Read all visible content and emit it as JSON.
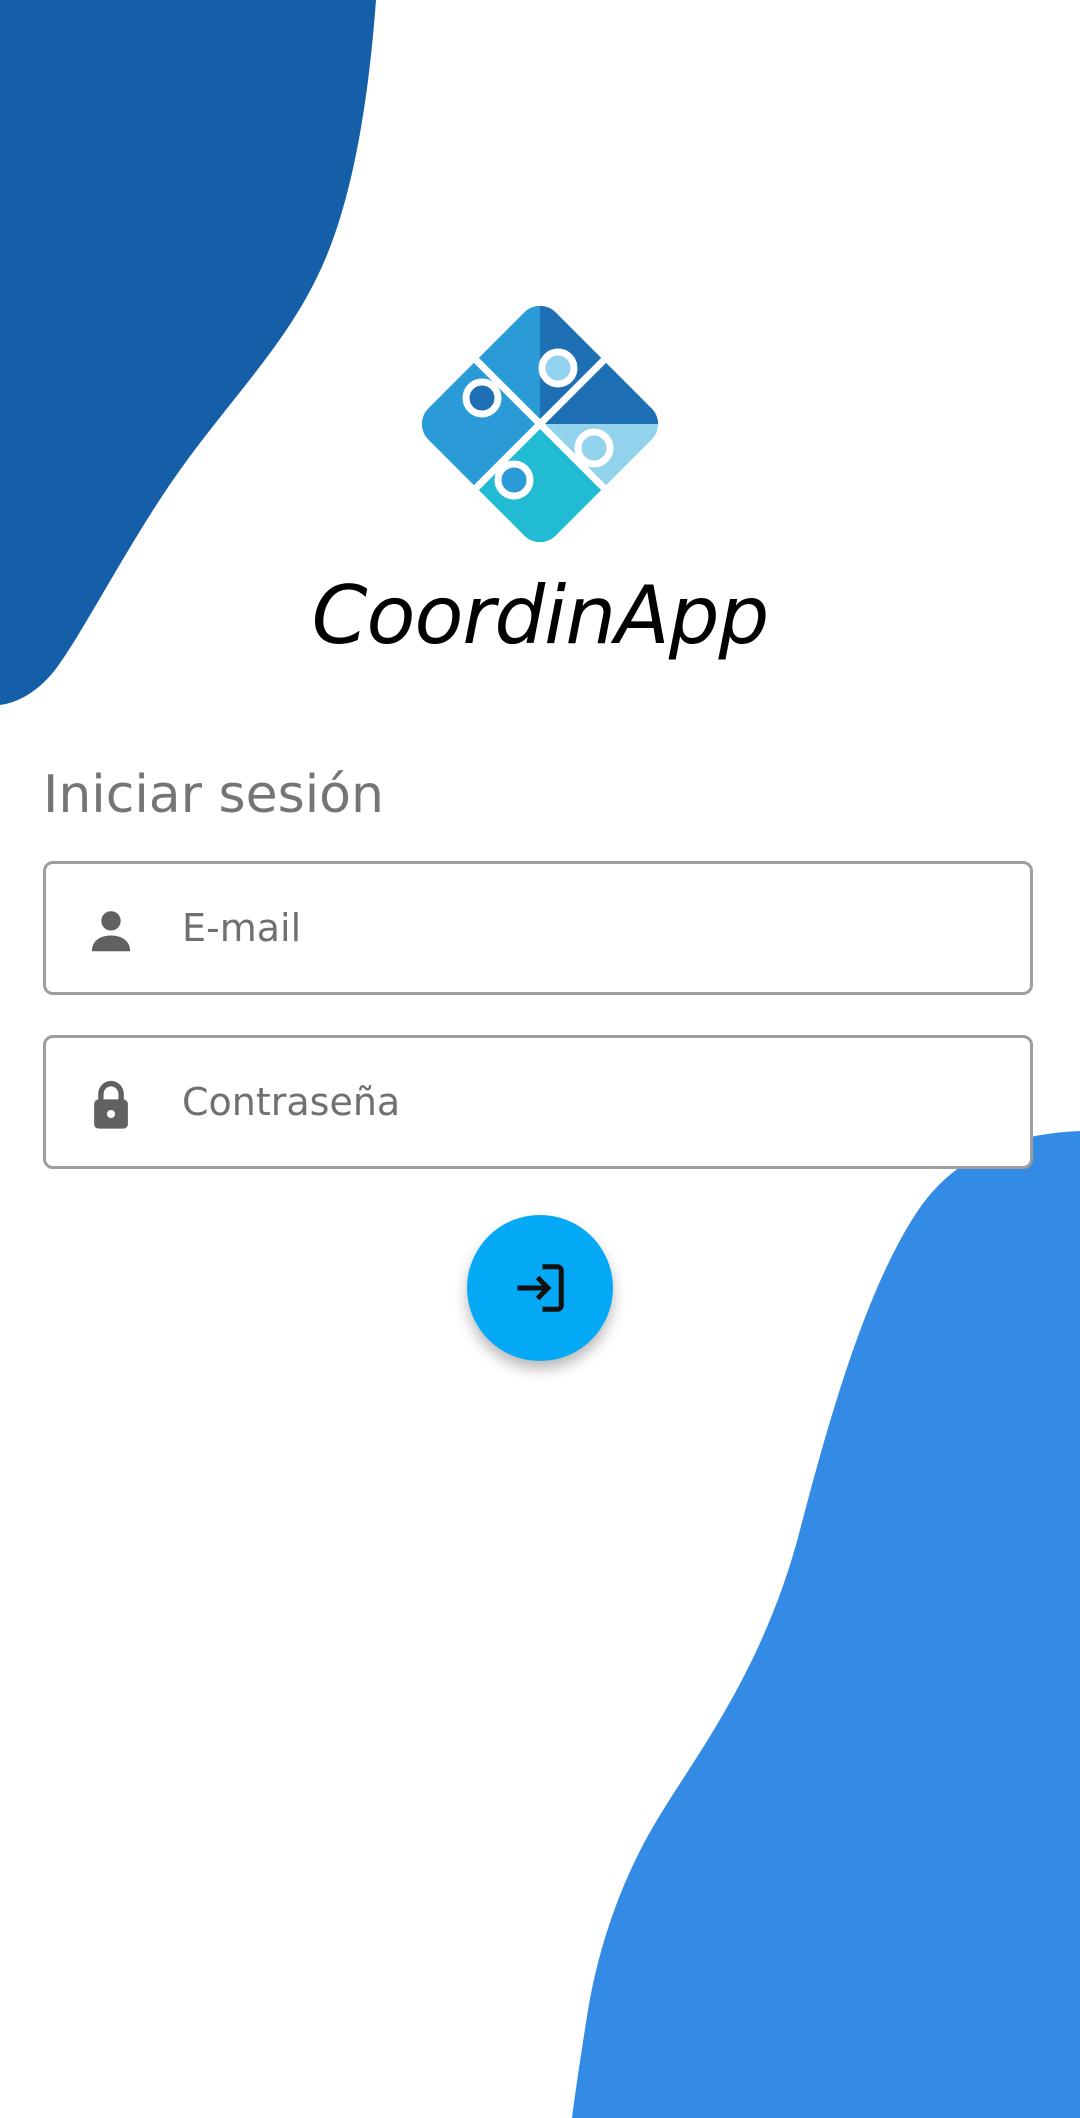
{
  "app": {
    "name": "CoordinApp"
  },
  "login": {
    "title": "Iniciar sesión",
    "email_placeholder": "E-mail",
    "password_placeholder": "Contraseña",
    "submit_icon": "login-icon"
  },
  "icons": {
    "email_field": "person-icon",
    "password_field": "lock-icon"
  },
  "colors": {
    "blob_top": "#155fa8",
    "blob_bottom": "#348be5",
    "fab": "#03a9f4",
    "logo_top": "#1f6fb5",
    "logo_left": "#2b9bd8",
    "logo_right": "#93d2ec",
    "logo_bottom": "#22bbd4"
  }
}
